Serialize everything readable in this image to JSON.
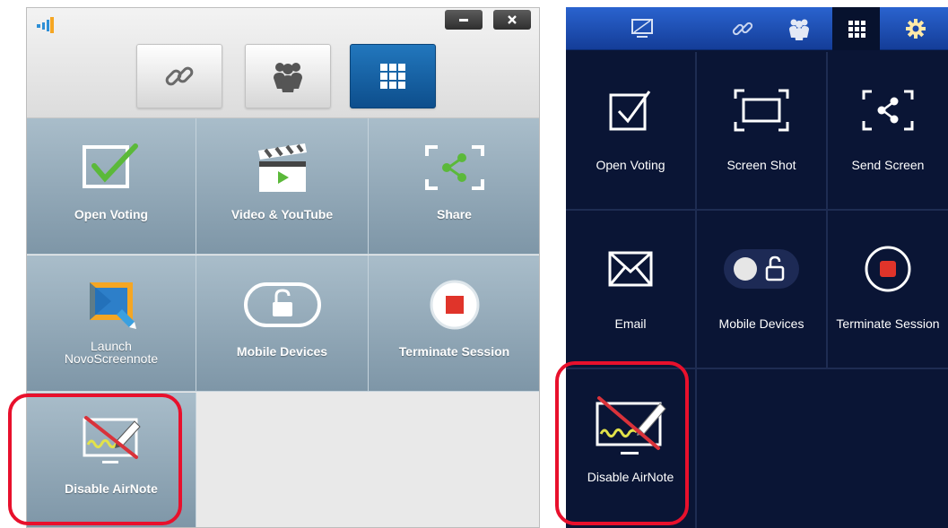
{
  "left": {
    "window_buttons": {
      "minimize": "–",
      "close": "✕"
    },
    "tabs": [
      {
        "name": "link",
        "icon": "link-icon",
        "selected": false
      },
      {
        "name": "users",
        "icon": "users-icon",
        "selected": false
      },
      {
        "name": "apps",
        "icon": "grid-icon",
        "selected": true
      }
    ],
    "tiles": [
      {
        "label": "Open Voting",
        "icon": "checkbox-icon"
      },
      {
        "label": "Video & YouTube",
        "icon": "clapperboard-icon"
      },
      {
        "label": "Share",
        "icon": "share-icon"
      },
      {
        "label_line1": "Launch",
        "label_line2": "NovoScreennote",
        "icon": "screennote-icon"
      },
      {
        "label": "Mobile Devices",
        "icon": "unlock-icon"
      },
      {
        "label": "Terminate Session",
        "icon": "stop-icon"
      },
      {
        "label": "Disable AirNote",
        "icon": "airnote-disabled-icon",
        "highlighted": true
      }
    ]
  },
  "right": {
    "tabs": [
      {
        "name": "display",
        "icon": "display-icon",
        "selected": false
      },
      {
        "name": "link",
        "icon": "link-icon",
        "selected": false
      },
      {
        "name": "users",
        "icon": "users-icon",
        "selected": false
      },
      {
        "name": "apps",
        "icon": "grid-icon",
        "selected": true
      },
      {
        "name": "settings",
        "icon": "gear-icon",
        "selected": false
      }
    ],
    "tiles": [
      {
        "label": "Open Voting",
        "icon": "checkbox-icon"
      },
      {
        "label": "Screen Shot",
        "icon": "screenshot-icon"
      },
      {
        "label": "Send Screen",
        "icon": "share-icon"
      },
      {
        "label": "Email",
        "icon": "envelope-icon"
      },
      {
        "label": "Mobile Devices",
        "icon": "toggle-lock-icon"
      },
      {
        "label": "Terminate Session",
        "icon": "stop-icon"
      },
      {
        "label": "Disable AirNote",
        "icon": "airnote-disabled-icon",
        "highlighted": true
      }
    ]
  },
  "colors": {
    "highlight": "#e8102c",
    "left_tile": "#8fa6b6",
    "left_selected_tab": "#1565b0",
    "right_background": "#0a1535",
    "right_topbar": "#1f4fb8",
    "check_green": "#5bb93a",
    "stop_red": "#e0342a"
  }
}
